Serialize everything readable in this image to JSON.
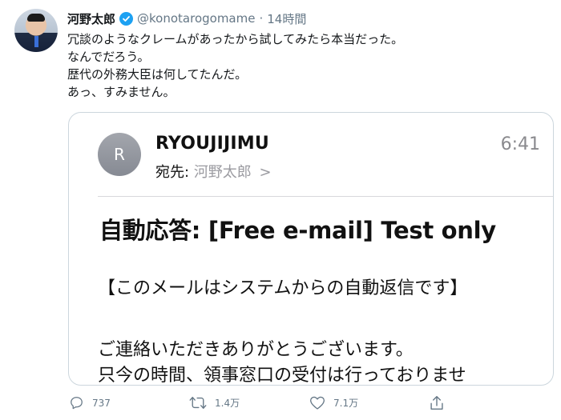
{
  "tweet": {
    "author_name": "河野太郎",
    "handle": "@konotarogomame",
    "separator": "·",
    "time": "14時間",
    "text_lines": [
      "冗談のようなクレームがあったから試してみたら本当だった。",
      "なんでだろう。",
      "歴代の外務大臣は何してたんだ。",
      "あっ、すみません。"
    ]
  },
  "email": {
    "avatar_letter": "R",
    "sender": "RYOUJIJIMU",
    "time": "6:41",
    "to_label": "宛先:",
    "to_name": "河野太郎",
    "to_chevron": ">",
    "subject": "自動応答: [Free e-mail] Test only",
    "body_lines": [
      "【このメールはシステムからの自動返信です】",
      "ご連絡いただきありがとうございます。",
      "只今の時間、領事窓口の受付は行っておりませ"
    ]
  },
  "actions": {
    "reply_count": "737",
    "retweet_count": "1.4万",
    "like_count": "7.1万"
  },
  "colors": {
    "verified": "#1da1f2",
    "secondary_text": "#657786",
    "card_border": "#ccd6dd"
  },
  "icons": [
    "verified-icon",
    "reply-icon",
    "retweet-icon",
    "like-icon",
    "share-icon"
  ]
}
